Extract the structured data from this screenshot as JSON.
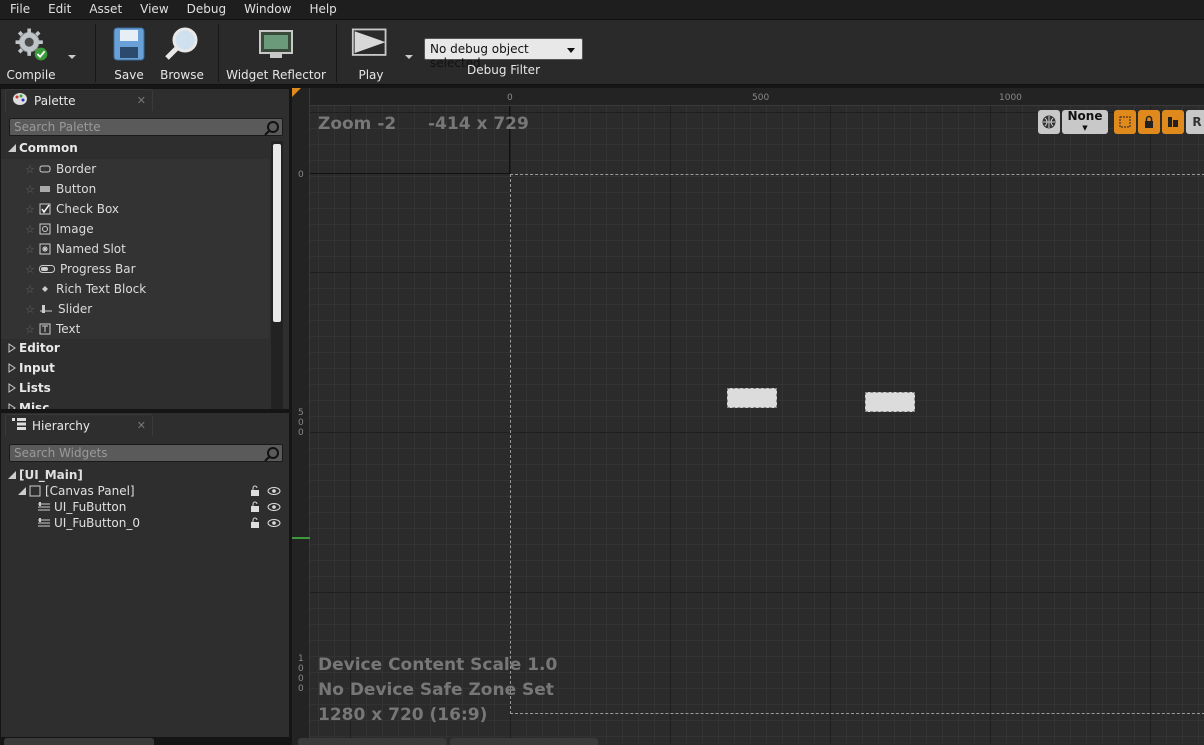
{
  "menu": [
    "File",
    "Edit",
    "Asset",
    "View",
    "Debug",
    "Window",
    "Help"
  ],
  "toolbar": {
    "compile": "Compile",
    "save": "Save",
    "browse": "Browse",
    "widget_reflector": "Widget Reflector",
    "play": "Play",
    "debug_object": "No debug object selected",
    "debug_filter": "Debug Filter"
  },
  "palette": {
    "tab": "Palette",
    "search_placeholder": "Search Palette",
    "categories": {
      "common": "Common",
      "editor": "Editor",
      "input": "Input",
      "lists": "Lists",
      "misc": "Misc"
    },
    "items": [
      "Border",
      "Button",
      "Check Box",
      "Image",
      "Named Slot",
      "Progress Bar",
      "Rich Text Block",
      "Slider",
      "Text"
    ]
  },
  "hierarchy": {
    "tab": "Hierarchy",
    "search_placeholder": "Search Widgets",
    "root": "[UI_Main]",
    "canvas": "[Canvas Panel]",
    "children": [
      "UI_FuButton",
      "UI_FuButton_0"
    ]
  },
  "viewport": {
    "zoom": "Zoom -2",
    "coords": "-414 x 729",
    "ruler_top": [
      "0",
      "500",
      "1000"
    ],
    "ruler_left": [
      "0",
      "500",
      "1000"
    ],
    "device_scale": "Device Content Scale 1.0",
    "safe_zone": "No Device Safe Zone Set",
    "resolution": "1280 x 720 (16:9)",
    "none_label": "None",
    "r_label": "R"
  },
  "colors": {
    "accent_orange": "#e08a1e",
    "bg": "#2e2e2e"
  }
}
